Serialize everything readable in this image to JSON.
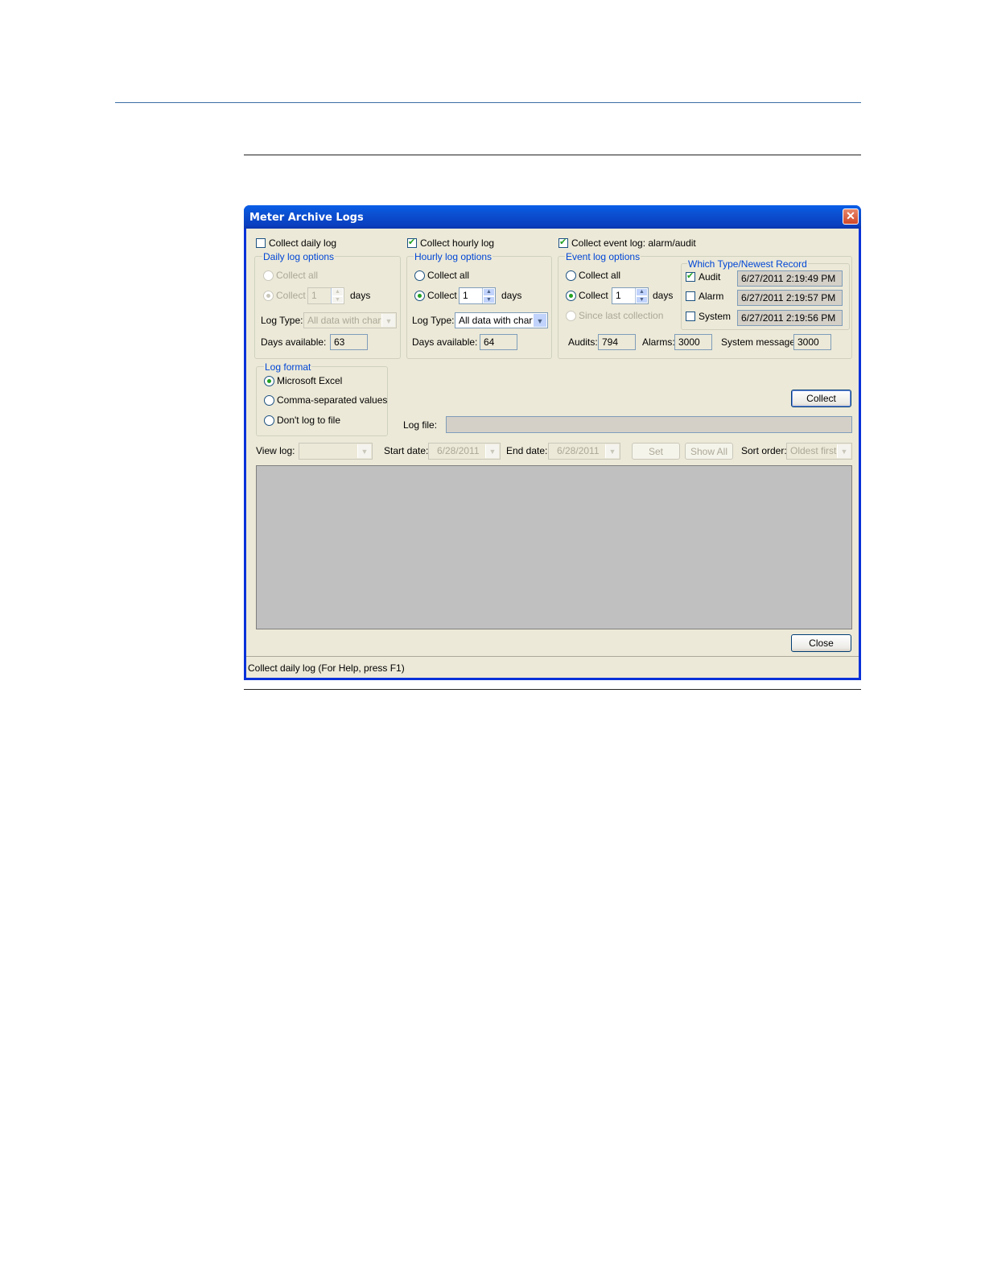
{
  "window": {
    "title": "Meter Archive Logs"
  },
  "daily": {
    "checkbox_label": "Collect daily log",
    "group_label": "Daily log options",
    "collect_all": "Collect all",
    "collect": "Collect",
    "days_value": "1",
    "days": "days",
    "log_type_label": "Log Type:",
    "log_type_value": "All data with charts",
    "days_available_label": "Days available:",
    "days_available_value": "63"
  },
  "hourly": {
    "checkbox_label": "Collect hourly log",
    "group_label": "Hourly log options",
    "collect_all": "Collect all",
    "collect": "Collect",
    "days_value": "1",
    "days": "days",
    "log_type_label": "Log Type:",
    "log_type_value": "All data with charts",
    "days_available_label": "Days available:",
    "days_available_value": "64"
  },
  "event": {
    "checkbox_label": "Collect event log: alarm/audit",
    "group_label": "Event log options",
    "collect_all": "Collect all",
    "collect": "Collect",
    "days_value": "1",
    "days": "days",
    "since_last": "Since last collection",
    "which_type_label": "Which Type/Newest Record",
    "audit_label": "Audit",
    "audit_value": "6/27/2011 2:19:49 PM",
    "alarm_label": "Alarm",
    "alarm_value": "6/27/2011 2:19:57 PM",
    "system_label": "System",
    "system_value": "6/27/2011 2:19:56 PM",
    "audits_label": "Audits:",
    "audits_value": "794",
    "alarms_label": "Alarms:",
    "alarms_value": "3000",
    "sysmsg_label": "System messages:",
    "sysmsg_value": "3000"
  },
  "format": {
    "group_label": "Log format",
    "excel": "Microsoft Excel",
    "csv": "Comma-separated values",
    "none": "Don't log to file"
  },
  "collect_button": "Collect",
  "log_file_label": "Log file:",
  "view": {
    "view_log_label": "View log:",
    "start_label": "Start date:",
    "start_value": "6/28/2011",
    "end_label": "End date:",
    "end_value": "6/28/2011",
    "set": "Set",
    "show_all": "Show All",
    "sort_label": "Sort order:",
    "sort_value": "Oldest first"
  },
  "close_button": "Close",
  "status_text": "Collect daily log (For Help, press F1)"
}
